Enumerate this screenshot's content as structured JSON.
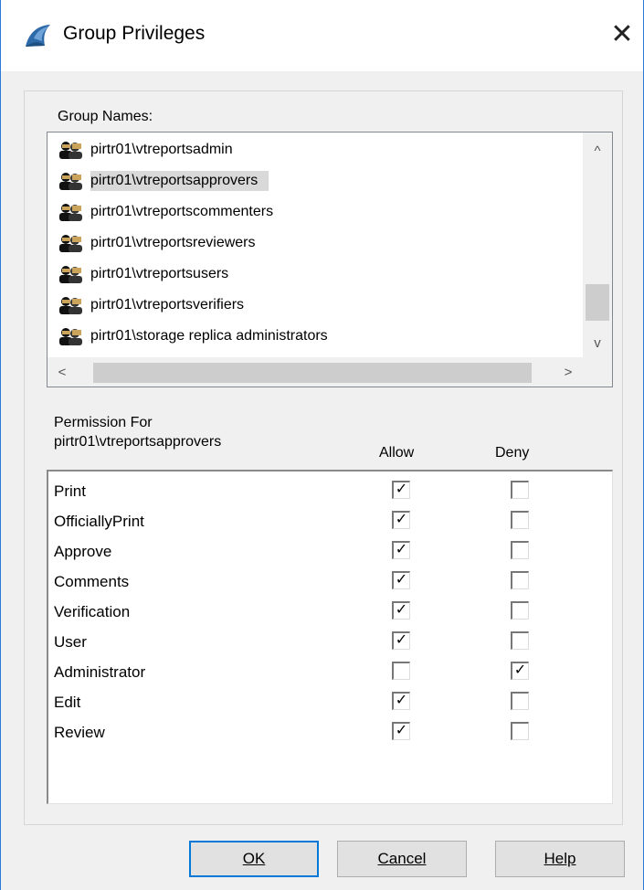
{
  "window": {
    "title": "Group Privileges",
    "close_glyph": "✕",
    "icon": "app-logo-icon"
  },
  "groups": {
    "label": "Group Names:",
    "items": [
      {
        "name": "pirtr01\\vtreportsadmin",
        "selected": false
      },
      {
        "name": "pirtr01\\vtreportsapprovers",
        "selected": true
      },
      {
        "name": "pirtr01\\vtreportscommenters",
        "selected": false
      },
      {
        "name": "pirtr01\\vtreportsreviewers",
        "selected": false
      },
      {
        "name": "pirtr01\\vtreportsusers",
        "selected": false
      },
      {
        "name": "pirtr01\\vtreportsverifiers",
        "selected": false
      },
      {
        "name": "pirtr01\\storage replica administrators",
        "selected": false
      }
    ],
    "scroll_up": "^",
    "scroll_down": "v",
    "scroll_left": "<",
    "scroll_right": ">"
  },
  "permissions": {
    "label_line1": "Permission For",
    "label_line2": "pirtr01\\vtreportsapprovers",
    "allow_header": "Allow",
    "deny_header": "Deny",
    "rows": [
      {
        "name": "Print",
        "allow": true,
        "deny": false
      },
      {
        "name": "OfficiallyPrint",
        "allow": true,
        "deny": false
      },
      {
        "name": "Approve",
        "allow": true,
        "deny": false
      },
      {
        "name": "Comments",
        "allow": true,
        "deny": false
      },
      {
        "name": "Verification",
        "allow": true,
        "deny": false
      },
      {
        "name": "User",
        "allow": true,
        "deny": false
      },
      {
        "name": "Administrator",
        "allow": false,
        "deny": true
      },
      {
        "name": "Edit",
        "allow": true,
        "deny": false
      },
      {
        "name": "Review",
        "allow": true,
        "deny": false
      }
    ]
  },
  "buttons": {
    "ok": "OK",
    "cancel": "Cancel",
    "help": "Help"
  },
  "colors": {
    "accent": "#0078d7",
    "border": "#2b7bd6",
    "selection": "#d9d9d9",
    "dialog_bg": "#f0f0f0"
  }
}
